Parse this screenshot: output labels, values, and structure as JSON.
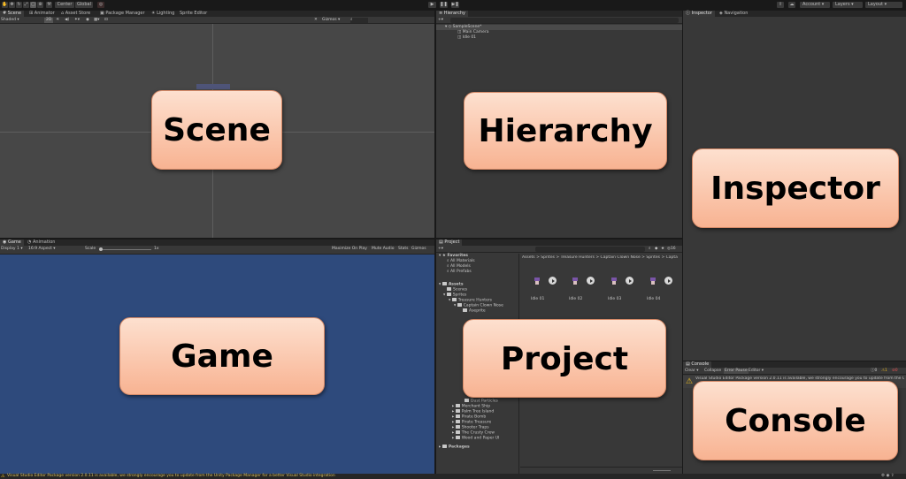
{
  "toolbar": {
    "center_label": "Center",
    "global_label": "Global",
    "account_label": "Account",
    "layers_label": "Layers",
    "layout_label": "Layout"
  },
  "scene_panel": {
    "tabs": [
      "Scene",
      "Animator",
      "Asset Store",
      "Package Manager",
      "Lighting",
      "Sprite Editor"
    ],
    "shading_mode": "Shaded",
    "mode_2d": "2D",
    "gizmos_label": "Gizmos"
  },
  "game_panel": {
    "tabs": [
      "Game",
      "Animation"
    ],
    "display": "Display 1",
    "aspect": "16:9 Aspect",
    "scale_label": "Scale",
    "scale_value": "1x",
    "options": [
      "Maximize On Play",
      "Mute Audio",
      "Stats",
      "Gizmos"
    ]
  },
  "hierarchy_panel": {
    "tab": "Hierarchy",
    "scene_name": "SampleScene*",
    "items": [
      "Main Camera",
      "Idle 01"
    ]
  },
  "inspector_panel": {
    "tabs": [
      "Inspector",
      "Navigation"
    ]
  },
  "project_panel": {
    "tab": "Project",
    "breadcrumb": "Assets > Sprites > Treasure Hunters > Captain Clown Nose > Sprites > Capta",
    "slider_value": "16",
    "favorites_label": "Favorites",
    "favorites": [
      "All Materials",
      "All Models",
      "All Prefabs"
    ],
    "assets_label": "Assets",
    "asset_tree": [
      "Scenes",
      "Sprites",
      "Treasure Hunters",
      "Captain Clown Nose",
      "Aseprite"
    ],
    "asset_tree_lower": [
      "Dust Particles",
      "Merchant Ship",
      "Palm Tree Island",
      "Pirate Bomb",
      "Pirate Treasure",
      "Shooter Traps",
      "The Crusty Crew",
      "Wood and Paper UI"
    ],
    "packages_label": "Packages",
    "assets": [
      "Idle 01",
      "Idle 02",
      "Idle 03",
      "Idle 04"
    ]
  },
  "console_panel": {
    "tab": "Console",
    "buttons": [
      "Clear",
      "Collapse",
      "Error Pause",
      "Editor"
    ],
    "counts": [
      "0",
      "1",
      "0"
    ],
    "message": "Visual Studio Editor Package version 2.0.11 is available, we strongly encourage you to update from the Unity Package Manager for a better Visual Studio integration"
  },
  "status_bar": {
    "message": "Visual Studio Editor Package version 2.0.11 is available, we strongly encourage you to update from the Unity Package Manager for a better Visual Studio integration"
  },
  "labels": {
    "scene": "Scene",
    "hierarchy": "Hierarchy",
    "inspector": "Inspector",
    "game": "Game",
    "project": "Project",
    "console": "Console"
  },
  "colors": {
    "overlay_fill": "#f8b392",
    "game_background": "#2e4a7c",
    "scene_background": "#474747"
  }
}
